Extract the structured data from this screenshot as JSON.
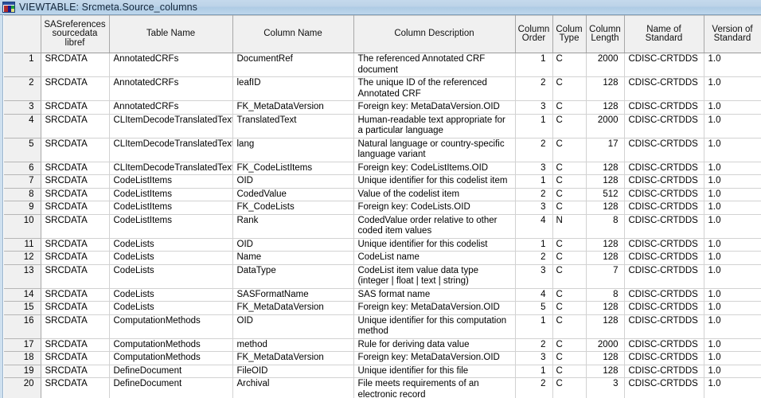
{
  "window": {
    "title": "VIEWTABLE: Srcmeta.Source_columns",
    "icon": "viewtable-window-icon",
    "titlebar_color": "#bcd3e8"
  },
  "grid": {
    "rownum_header": "",
    "columns": [
      {
        "key": "libref",
        "label": "SASreferences sourcedata libref",
        "lines": [
          "SASreferences",
          "sourcedata",
          "libref"
        ]
      },
      {
        "key": "table",
        "label": "Table Name",
        "lines": [
          "Table Name"
        ]
      },
      {
        "key": "column",
        "label": "Column Name",
        "lines": [
          "Column Name"
        ]
      },
      {
        "key": "desc",
        "label": "Column Description",
        "lines": [
          "Column Description"
        ]
      },
      {
        "key": "order",
        "label": "Column Order",
        "lines": [
          "Column",
          "Order"
        ]
      },
      {
        "key": "type",
        "label": "Colum Type",
        "lines": [
          "Colum",
          "Type"
        ]
      },
      {
        "key": "length",
        "label": "Column Length",
        "lines": [
          "Column",
          "Length"
        ]
      },
      {
        "key": "standard",
        "label": "Name of Standard",
        "lines": [
          "Name of Standard"
        ]
      },
      {
        "key": "version",
        "label": "Version of Standard",
        "lines": [
          "Version of",
          "Standard"
        ]
      }
    ],
    "rows": [
      {
        "n": "1",
        "libref": "SRCDATA",
        "table": "AnnotatedCRFs",
        "column": "DocumentRef",
        "desc": "The referenced Annotated CRF document",
        "order": "1",
        "type": "C",
        "length": "2000",
        "standard": "CDISC-CRTDDS",
        "version": "1.0",
        "tall": true
      },
      {
        "n": "2",
        "libref": "SRCDATA",
        "table": "AnnotatedCRFs",
        "column": "leafID",
        "desc": "The unique ID of the referenced Annotated CRF",
        "order": "2",
        "type": "C",
        "length": "128",
        "standard": "CDISC-CRTDDS",
        "version": "1.0",
        "tall": true
      },
      {
        "n": "3",
        "libref": "SRCDATA",
        "table": "AnnotatedCRFs",
        "column": "FK_MetaDataVersion",
        "desc": "Foreign key: MetaDataVersion.OID",
        "order": "3",
        "type": "C",
        "length": "128",
        "standard": "CDISC-CRTDDS",
        "version": "1.0",
        "tall": false
      },
      {
        "n": "4",
        "libref": "SRCDATA",
        "table": "CLItemDecodeTranslatedText",
        "column": "TranslatedText",
        "desc": "Human-readable text appropriate for a particular language",
        "order": "1",
        "type": "C",
        "length": "2000",
        "standard": "CDISC-CRTDDS",
        "version": "1.0",
        "tall": true
      },
      {
        "n": "5",
        "libref": "SRCDATA",
        "table": "CLItemDecodeTranslatedText",
        "column": "lang",
        "desc": "Natural language or country-specific language variant",
        "order": "2",
        "type": "C",
        "length": "17",
        "standard": "CDISC-CRTDDS",
        "version": "1.0",
        "tall": true
      },
      {
        "n": "6",
        "libref": "SRCDATA",
        "table": "CLItemDecodeTranslatedText",
        "column": "FK_CodeListItems",
        "desc": "Foreign key: CodeListItems.OID",
        "order": "3",
        "type": "C",
        "length": "128",
        "standard": "CDISC-CRTDDS",
        "version": "1.0",
        "tall": false
      },
      {
        "n": "7",
        "libref": "SRCDATA",
        "table": "CodeListItems",
        "column": "OID",
        "desc": "Unique identifier for this codelist item",
        "order": "1",
        "type": "C",
        "length": "128",
        "standard": "CDISC-CRTDDS",
        "version": "1.0",
        "tall": false
      },
      {
        "n": "8",
        "libref": "SRCDATA",
        "table": "CodeListItems",
        "column": "CodedValue",
        "desc": "Value of the codelist item",
        "order": "2",
        "type": "C",
        "length": "512",
        "standard": "CDISC-CRTDDS",
        "version": "1.0",
        "tall": false
      },
      {
        "n": "9",
        "libref": "SRCDATA",
        "table": "CodeListItems",
        "column": "FK_CodeLists",
        "desc": "Foreign key: CodeLists.OID",
        "order": "3",
        "type": "C",
        "length": "128",
        "standard": "CDISC-CRTDDS",
        "version": "1.0",
        "tall": false
      },
      {
        "n": "10",
        "libref": "SRCDATA",
        "table": "CodeListItems",
        "column": "Rank",
        "desc": "CodedValue order relative to other coded item values",
        "order": "4",
        "type": "N",
        "length": "8",
        "standard": "CDISC-CRTDDS",
        "version": "1.0",
        "tall": true
      },
      {
        "n": "11",
        "libref": "SRCDATA",
        "table": "CodeLists",
        "column": "OID",
        "desc": "Unique identifier for this codelist",
        "order": "1",
        "type": "C",
        "length": "128",
        "standard": "CDISC-CRTDDS",
        "version": "1.0",
        "tall": false
      },
      {
        "n": "12",
        "libref": "SRCDATA",
        "table": "CodeLists",
        "column": "Name",
        "desc": "CodeList name",
        "order": "2",
        "type": "C",
        "length": "128",
        "standard": "CDISC-CRTDDS",
        "version": "1.0",
        "tall": false
      },
      {
        "n": "13",
        "libref": "SRCDATA",
        "table": "CodeLists",
        "column": "DataType",
        "desc": "CodeList item value data type (integer | float | text | string)",
        "order": "3",
        "type": "C",
        "length": "7",
        "standard": "CDISC-CRTDDS",
        "version": "1.0",
        "tall": true
      },
      {
        "n": "14",
        "libref": "SRCDATA",
        "table": "CodeLists",
        "column": "SASFormatName",
        "desc": "SAS format name",
        "order": "4",
        "type": "C",
        "length": "8",
        "standard": "CDISC-CRTDDS",
        "version": "1.0",
        "tall": false
      },
      {
        "n": "15",
        "libref": "SRCDATA",
        "table": "CodeLists",
        "column": "FK_MetaDataVersion",
        "desc": "Foreign key: MetaDataVersion.OID",
        "order": "5",
        "type": "C",
        "length": "128",
        "standard": "CDISC-CRTDDS",
        "version": "1.0",
        "tall": false
      },
      {
        "n": "16",
        "libref": "SRCDATA",
        "table": "ComputationMethods",
        "column": "OID",
        "desc": "Unique identifier for this computation method",
        "order": "1",
        "type": "C",
        "length": "128",
        "standard": "CDISC-CRTDDS",
        "version": "1.0",
        "tall": true
      },
      {
        "n": "17",
        "libref": "SRCDATA",
        "table": "ComputationMethods",
        "column": "method",
        "desc": "Rule for deriving data value",
        "order": "2",
        "type": "C",
        "length": "2000",
        "standard": "CDISC-CRTDDS",
        "version": "1.0",
        "tall": false
      },
      {
        "n": "18",
        "libref": "SRCDATA",
        "table": "ComputationMethods",
        "column": "FK_MetaDataVersion",
        "desc": "Foreign key: MetaDataVersion.OID",
        "order": "3",
        "type": "C",
        "length": "128",
        "standard": "CDISC-CRTDDS",
        "version": "1.0",
        "tall": false
      },
      {
        "n": "19",
        "libref": "SRCDATA",
        "table": "DefineDocument",
        "column": "FileOID",
        "desc": "Unique identifier for this file",
        "order": "1",
        "type": "C",
        "length": "128",
        "standard": "CDISC-CRTDDS",
        "version": "1.0",
        "tall": false
      },
      {
        "n": "20",
        "libref": "SRCDATA",
        "table": "DefineDocument",
        "column": "Archival",
        "desc": "File meets requirements of an electronic record",
        "order": "2",
        "type": "C",
        "length": "3",
        "standard": "CDISC-CRTDDS",
        "version": "1.0",
        "tall": true
      }
    ]
  }
}
